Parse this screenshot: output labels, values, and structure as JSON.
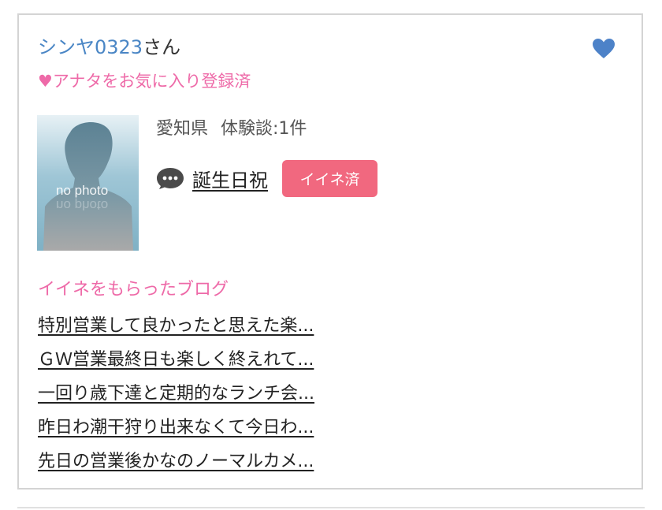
{
  "profile": {
    "name": "シンヤ0323",
    "name_suffix": "さん",
    "favorite_status": "♥アナタをお気に入り登録済",
    "prefecture": "愛知県",
    "experience_reviews": "体験談:1件",
    "birthday_link": "誕生日祝",
    "iine_badge": "イイネ済",
    "favorite_icon": "heart-icon",
    "comment_icon": "speech-bubble-icon"
  },
  "avatar": {
    "placeholder_text": "no photo"
  },
  "blogs": {
    "heading": "イイネをもらったブログ",
    "items": [
      {
        "title": "特別営業して良かったと思えた楽..."
      },
      {
        "title": "ＧＷ営業最終日も楽しく終えれて..."
      },
      {
        "title": "一回り歳下達と定期的なランチ会..."
      },
      {
        "title": "昨日わ潮干狩り出来なくて今日わ..."
      },
      {
        "title": "先日の営業後かなのノーマルカメ..."
      }
    ]
  },
  "colors": {
    "name_link": "#4a86c5",
    "pink_text": "#ee6aa8",
    "badge_bg": "#f1687f",
    "heart": "#4d82c8",
    "card_border": "#d4d4d4"
  }
}
